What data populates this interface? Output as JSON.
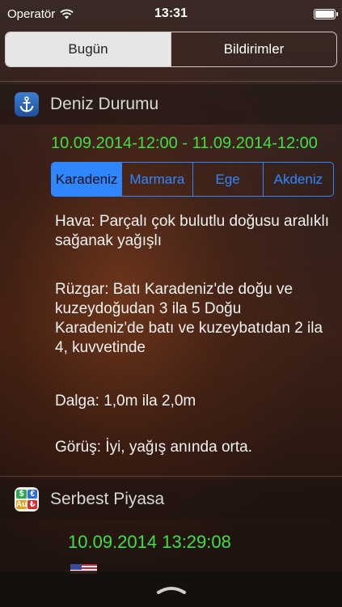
{
  "status": {
    "carrier": "Operatör",
    "time": "13:31"
  },
  "top_segments": {
    "today": "Bugün",
    "notifications": "Bildirimler"
  },
  "sea_section": {
    "title": "Deniz Durumu",
    "date_range": "10.09.2014-12:00 - 11.09.2014-12:00",
    "tabs": [
      "Karadeniz",
      "Marmara",
      "Ege",
      "Akdeniz"
    ],
    "selected_tab": "Karadeniz",
    "weather": "Hava: Parçalı çok bulutlu doğusu aralıklı sağanak yağışlı",
    "wind": "Rüzgar: Batı Karadeniz'de doğu ve kuzeydoğudan 3 ila 5   Doğu Karadeniz'de batı ve kuzeybatıdan 2 ila 4, kuvvetinde",
    "wave": "Dalga: 1,0m ila 2,0m",
    "visibility": "Görüş: İyi, yağış anında orta."
  },
  "market_section": {
    "title": "Serbest Piyasa",
    "timestamp": "10.09.2014 13:29:08"
  },
  "icons": {
    "money": [
      "$",
      "€",
      "Au",
      "₺"
    ]
  },
  "colors": {
    "green": "#3fe03f",
    "accent_blue": "#2f86ff"
  }
}
